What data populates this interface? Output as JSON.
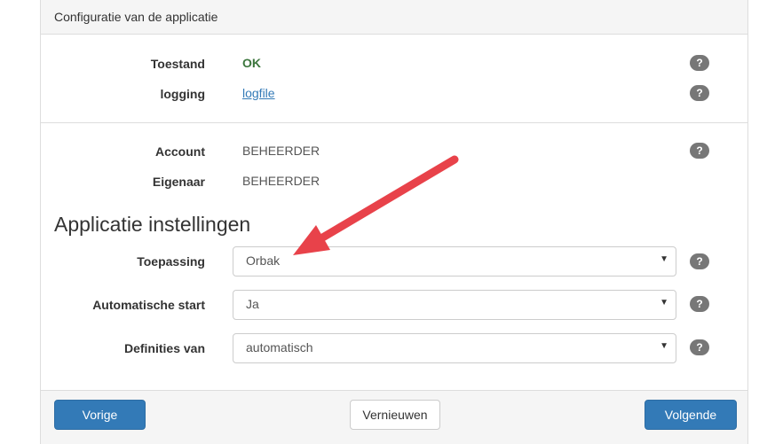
{
  "panel": {
    "heading": "Configuratie van de applicatie"
  },
  "status": {
    "rows": [
      {
        "label": "Toestand",
        "value": "OK"
      },
      {
        "label": "logging",
        "value": "logfile"
      }
    ]
  },
  "account": {
    "rows": [
      {
        "label": "Account",
        "value": "BEHEERDER"
      },
      {
        "label": "Eigenaar",
        "value": "BEHEERDER"
      }
    ]
  },
  "settings": {
    "title": "Applicatie instellingen",
    "fields": [
      {
        "label": "Toepassing",
        "value": "Orbak"
      },
      {
        "label": "Automatische start",
        "value": "Ja"
      },
      {
        "label": "Definities van",
        "value": "automatisch"
      }
    ]
  },
  "help_symbol": "?",
  "caret_symbol": "▼",
  "footer": {
    "prev_label": "Vorige",
    "refresh_label": "Vernieuwen",
    "next_label": "Volgende"
  },
  "annotation": {
    "type": "arrow",
    "color": "#e8424a"
  },
  "colors": {
    "primary": "#337ab7",
    "ok": "#3c763d",
    "help_badge": "#777777"
  }
}
